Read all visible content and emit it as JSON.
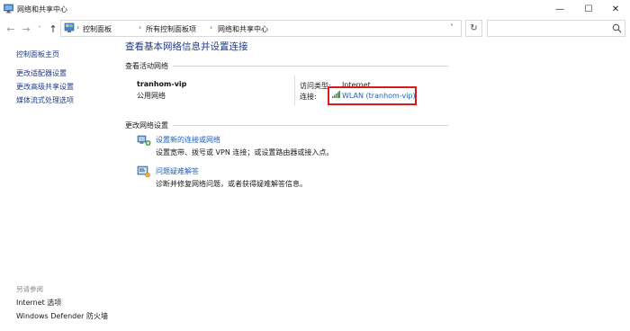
{
  "window": {
    "title": "网络和共享中心",
    "buttons": {
      "minimize": "—",
      "maximize": "☐",
      "close": "✕"
    }
  },
  "nav": {
    "back": "←",
    "forward": "→",
    "recent": "˅",
    "up": "↑",
    "breadcrumb": [
      "控制面板",
      "所有控制面板项",
      "网络和共享中心"
    ],
    "separator": "›",
    "dropdown": "˅",
    "refresh": "↻",
    "search_placeholder": ""
  },
  "sidebar": {
    "items": [
      {
        "label": "控制面板主页"
      },
      {
        "label": "更改适配器设置"
      },
      {
        "label": "更改高级共享设置"
      },
      {
        "label": "媒体流式处理选项"
      }
    ],
    "see_also_label": "另请参阅",
    "see_also": [
      {
        "label": "Internet 选项"
      },
      {
        "label": "Windows Defender 防火墙"
      }
    ]
  },
  "main": {
    "title": "查看基本网络信息并设置连接",
    "active_networks_label": "查看活动网络",
    "network": {
      "name": "tranhom-vip",
      "type": "公用网络",
      "access_type_label": "访问类型:",
      "access_type_value": "Internet",
      "connection_label": "连接:",
      "connection_value": "WLAN (tranhom-vip)"
    },
    "change_settings_label": "更改网络设置",
    "tasks": [
      {
        "icon": "network-setup-icon",
        "title": "设置新的连接或网络",
        "desc": "设置宽带、拨号或 VPN 连接；或设置路由器或接入点。"
      },
      {
        "icon": "troubleshoot-icon",
        "title": "问题疑难解答",
        "desc": "诊断并修复网络问题，或者获得疑难解答信息。"
      }
    ]
  },
  "colors": {
    "link": "#1f5fbf",
    "title": "#1e3a8a",
    "highlight": "#d91a1a"
  }
}
